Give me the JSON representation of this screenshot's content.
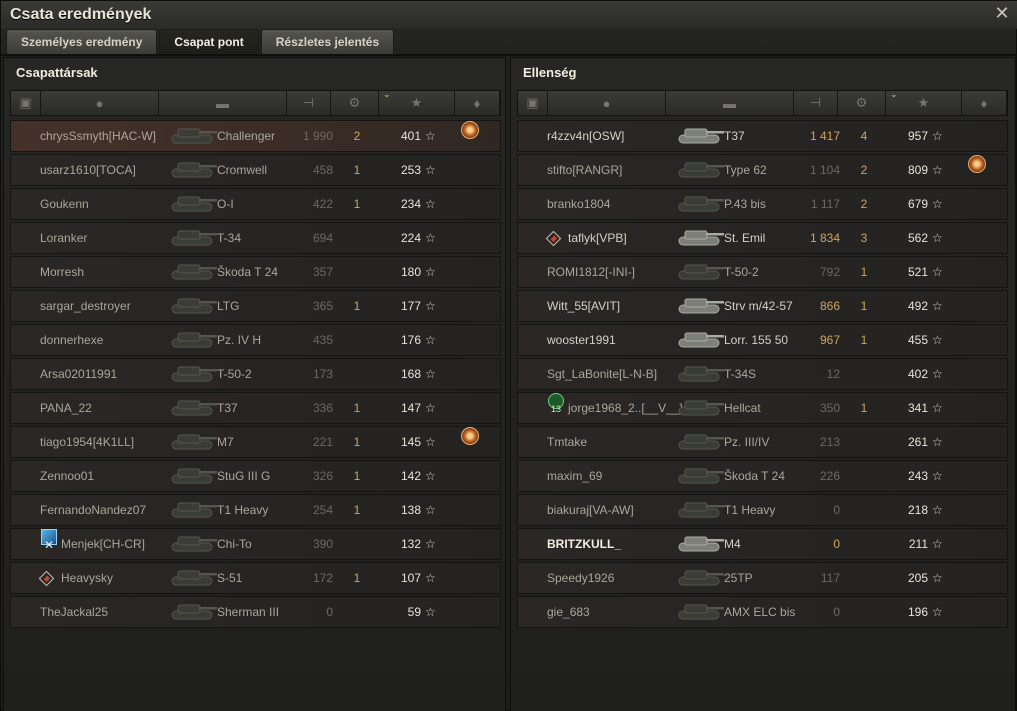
{
  "window": {
    "title": "Csata eredmények"
  },
  "tabs": [
    {
      "label": "Személyes eredmény",
      "active": false
    },
    {
      "label": "Csapat pont",
      "active": true
    },
    {
      "label": "Részletes jelentés",
      "active": false
    }
  ],
  "columns": [
    "tank-tier-icon",
    "player-icon",
    "vehicle-icon",
    "damage-icon",
    "kills-icon",
    "xp-star-icon",
    "medal-icon"
  ],
  "left_team": {
    "title": "Csapattársak",
    "rows": [
      {
        "player": "chrysSsmyth[HAC-W]",
        "vehicle": "Challenger",
        "damage": "1 990",
        "kills": "2",
        "xp": "401",
        "medal": true,
        "mine": true,
        "alive": false
      },
      {
        "player": "usarz1610[TOCA]",
        "vehicle": "Cromwell",
        "damage": "458",
        "kills": "1",
        "xp": "253",
        "medal": false,
        "alive": false
      },
      {
        "player": "Goukenn",
        "vehicle": "O-I",
        "damage": "422",
        "kills": "1",
        "xp": "234",
        "medal": false,
        "alive": false
      },
      {
        "player": "Loranker",
        "vehicle": "T-34",
        "damage": "694",
        "kills": "",
        "xp": "224",
        "medal": false,
        "alive": false
      },
      {
        "player": "Morresh",
        "vehicle": "Škoda T 24",
        "damage": "357",
        "kills": "",
        "xp": "180",
        "medal": false,
        "alive": false
      },
      {
        "player": "sargar_destroyer",
        "vehicle": "LTG",
        "damage": "365",
        "kills": "1",
        "xp": "177",
        "medal": false,
        "alive": false
      },
      {
        "player": "donnerhexe",
        "vehicle": "Pz. IV H",
        "damage": "435",
        "kills": "",
        "xp": "176",
        "medal": false,
        "alive": false
      },
      {
        "player": "Arsa02011991",
        "vehicle": "T-50-2",
        "damage": "173",
        "kills": "",
        "xp": "168",
        "medal": false,
        "alive": false
      },
      {
        "player": "PANA_22",
        "vehicle": "T37",
        "damage": "336",
        "kills": "1",
        "xp": "147",
        "medal": false,
        "alive": false
      },
      {
        "player": "tiago1954[4K1LL]",
        "vehicle": "M7",
        "damage": "221",
        "kills": "1",
        "xp": "145",
        "medal": true,
        "alive": false
      },
      {
        "player": "Zennoo01",
        "vehicle": "StuG III G",
        "damage": "326",
        "kills": "1",
        "xp": "142",
        "medal": false,
        "alive": false
      },
      {
        "player": "FernandoNandez07",
        "vehicle": "T1 Heavy",
        "damage": "254",
        "kills": "1",
        "xp": "138",
        "medal": false,
        "alive": false
      },
      {
        "player": "Menjek[CH-CR]",
        "vehicle": "Chi-To",
        "damage": "390",
        "kills": "",
        "xp": "132",
        "medal": false,
        "badge": "clan",
        "alive": false
      },
      {
        "player": "Heavysky",
        "vehicle": "S-51",
        "damage": "172",
        "kills": "1",
        "xp": "107",
        "medal": false,
        "badge": "diamond",
        "alive": false
      },
      {
        "player": "TheJackal25",
        "vehicle": "Sherman III",
        "damage": "0",
        "kills": "",
        "xp": "59",
        "medal": false,
        "alive": false
      }
    ]
  },
  "right_team": {
    "title": "Ellenség",
    "rows": [
      {
        "player": "r4zzv4n[OSW]",
        "vehicle": "T37",
        "damage": "1 417",
        "kills": "4",
        "xp": "957",
        "medal": false,
        "alive": true,
        "gold": true
      },
      {
        "player": "stifto[RANGR]",
        "vehicle": "Type 62",
        "damage": "1 104",
        "kills": "2",
        "xp": "809",
        "medal": true,
        "alive": false
      },
      {
        "player": "branko1804",
        "vehicle": "P.43 bis",
        "damage": "1 117",
        "kills": "2",
        "xp": "679",
        "medal": false,
        "alive": false
      },
      {
        "player": "taflyk[VPB]",
        "vehicle": "St. Emil",
        "damage": "1 834",
        "kills": "3",
        "xp": "562",
        "medal": false,
        "badge": "diamond",
        "alive": true,
        "gold": true
      },
      {
        "player": "ROMI1812[-INI-]",
        "vehicle": "T-50-2",
        "damage": "792",
        "kills": "1",
        "xp": "521",
        "medal": false,
        "alive": false
      },
      {
        "player": "Witt_55[AVIT]",
        "vehicle": "Strv m/42-57",
        "damage": "866",
        "kills": "1",
        "xp": "492",
        "medal": false,
        "alive": true,
        "gold": true
      },
      {
        "player": "wooster1991",
        "vehicle": "Lorr. 155 50",
        "damage": "967",
        "kills": "1",
        "xp": "455",
        "medal": false,
        "alive": true,
        "gold": true
      },
      {
        "player": "Sgt_LaBonite[L-N-B]",
        "vehicle": "T-34S",
        "damage": "12",
        "kills": "",
        "xp": "402",
        "medal": false,
        "alive": false
      },
      {
        "player": "jorge1968_2..[__V__]",
        "vehicle": "Hellcat",
        "damage": "350",
        "kills": "1",
        "xp": "341",
        "medal": false,
        "badge": "green",
        "badge_text": "13",
        "alive": false
      },
      {
        "player": "Tmtake",
        "vehicle": "Pz. III/IV",
        "damage": "213",
        "kills": "",
        "xp": "261",
        "medal": false,
        "alive": false
      },
      {
        "player": "maxim_69",
        "vehicle": "Škoda T 24",
        "damage": "226",
        "kills": "",
        "xp": "243",
        "medal": false,
        "alive": false
      },
      {
        "player": "biakuraj[VA-AW]",
        "vehicle": "T1 Heavy",
        "damage": "0",
        "kills": "",
        "xp": "218",
        "medal": false,
        "alive": false
      },
      {
        "player": "BRITZKULL_",
        "vehicle": "M4",
        "damage": "0",
        "kills": "",
        "xp": "211",
        "medal": false,
        "alive": true,
        "hi": true,
        "gold": true
      },
      {
        "player": "Speedy1926",
        "vehicle": "25TP",
        "damage": "117",
        "kills": "",
        "xp": "205",
        "medal": false,
        "alive": false
      },
      {
        "player": "gie_683",
        "vehicle": "AMX ELC bis",
        "damage": "0",
        "kills": "",
        "xp": "196",
        "medal": false,
        "alive": false
      }
    ]
  }
}
